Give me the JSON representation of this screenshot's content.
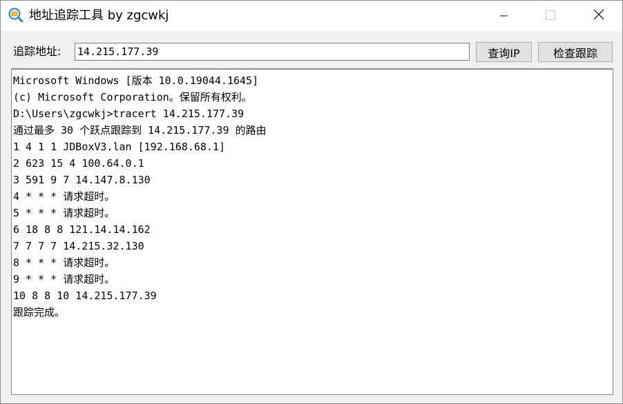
{
  "window": {
    "title": "地址追踪工具 by zgcwkj",
    "icon": "magnifier-folder-icon",
    "controls": [
      "minimize-icon",
      "maximize-icon",
      "close-icon"
    ]
  },
  "toolbar": {
    "address_label": "追踪地址:",
    "address_value": "14.215.177.39",
    "query_ip_label": "查询IP",
    "trace_label": "检查跟踪"
  },
  "output": {
    "lines": [
      "Microsoft Windows [版本 10.0.19044.1645]",
      "(c) Microsoft Corporation。保留所有权利。",
      "D:\\Users\\zgcwkj>tracert 14.215.177.39",
      "通过最多 30 个跃点跟踪到 14.215.177.39 的路由",
      "1 4 1 1 JDBoxV3.lan [192.168.68.1]",
      "2 623 15 4 100.64.0.1",
      "3 591 9 7 14.147.8.130",
      "4 * * * 请求超时。",
      "5 * * * 请求超时。",
      "6 18 8 8 121.14.14.162",
      "7 7 7 7 14.215.32.130",
      "8 * * * 请求超时。",
      "9 * * * 请求超时。",
      "10 8 8 10 14.215.177.39",
      "跟踪完成。"
    ]
  },
  "colors": {
    "window_bg": "#f0f0f0",
    "titlebar_bg": "#ffffff",
    "button_bg": "#e1e1e1",
    "border": "#828790"
  }
}
